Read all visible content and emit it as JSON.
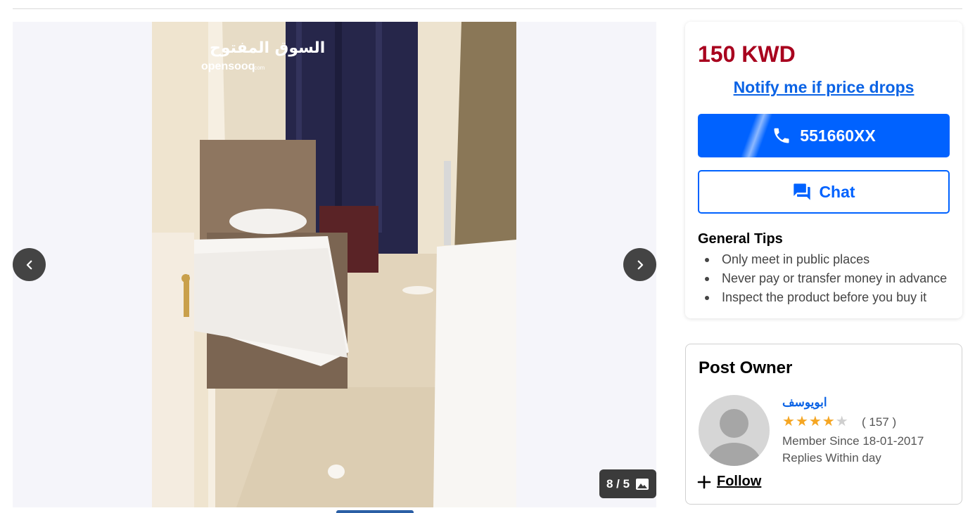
{
  "gallery": {
    "counter": "8 / 5",
    "watermark_ar": "السوق المفتوح",
    "watermark_en": "opensooq",
    "watermark_tld": ".com"
  },
  "price_card": {
    "price": "150 KWD",
    "notify_link": "Notify me if price drops",
    "phone_label": "551660XX",
    "chat_label": "Chat",
    "tips_title": "General Tips",
    "tips": [
      "Only meet in public places",
      "Never pay or transfer money in advance",
      "Inspect the product before you buy it"
    ]
  },
  "owner": {
    "title": "Post Owner",
    "name": "ابويوسف",
    "rating": 4,
    "rating_max": 5,
    "rating_count": "( 157 )",
    "member_since": "Member Since 18-01-2017",
    "replies": "Replies Within day",
    "follow_label": "Follow"
  },
  "colors": {
    "price": "#a8001e",
    "accent": "#0062ff",
    "link": "#0b63e5",
    "star": "#f5a623"
  }
}
